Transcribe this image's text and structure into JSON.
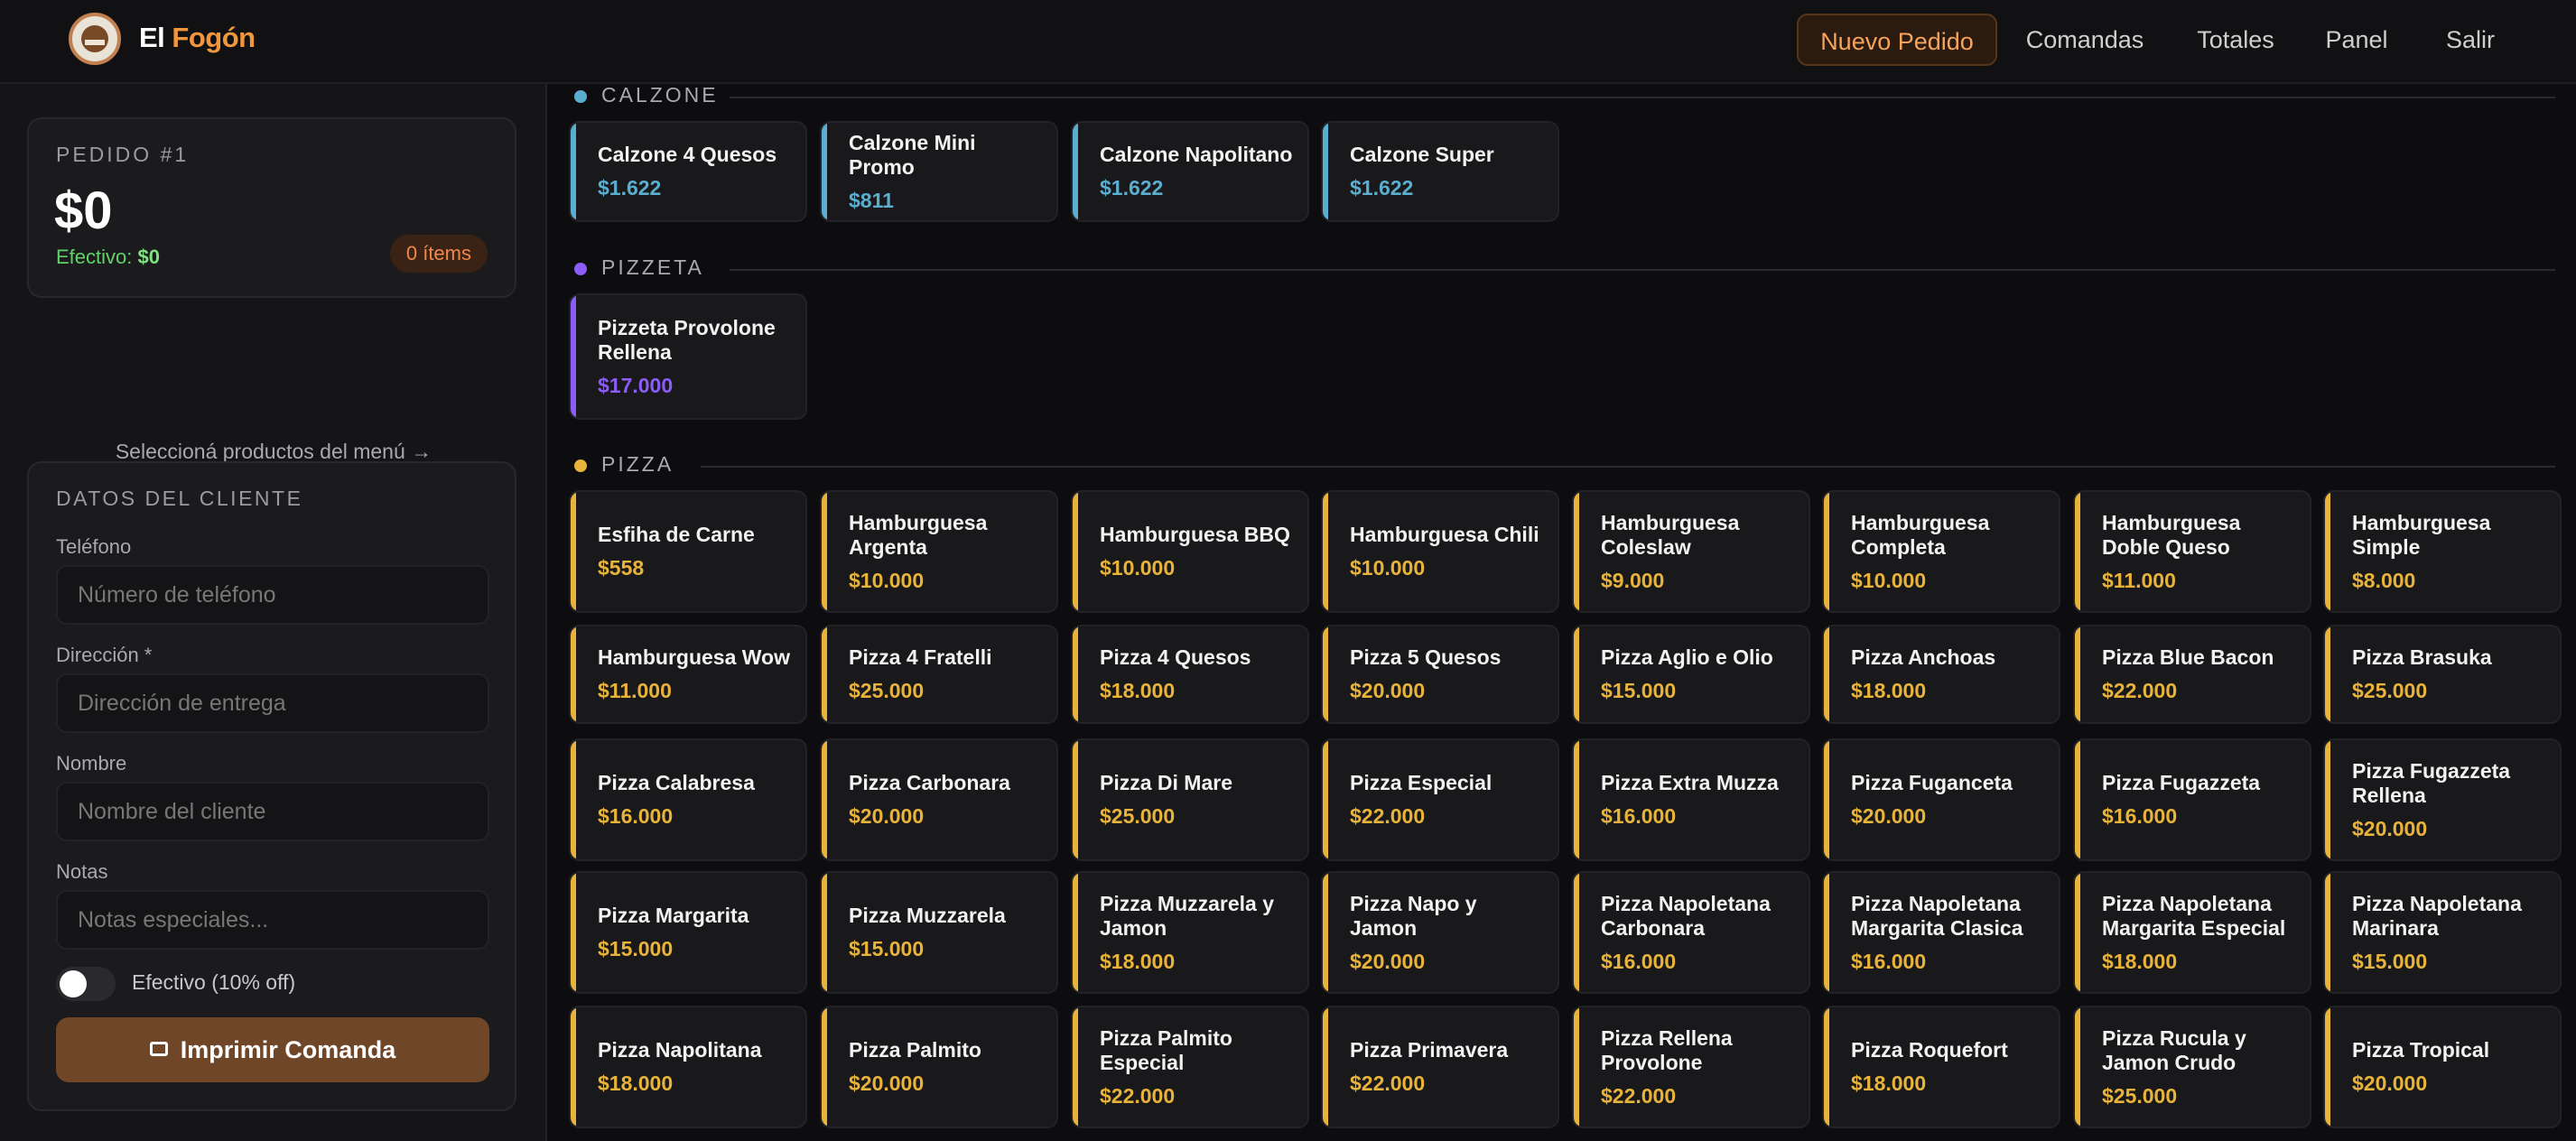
{
  "header": {
    "brand_part1": "El",
    "brand_part2": "Fogón",
    "nav": [
      "Nuevo Pedido",
      "Comandas",
      "Totales",
      "Panel",
      "Salir"
    ]
  },
  "order": {
    "label": "PEDIDO #1",
    "total": "$0",
    "cash_label": "Efectivo:",
    "cash_value": "$0",
    "items_badge": "0 ítems",
    "hint": "Seleccioná productos del menú →"
  },
  "customer": {
    "title": "DATOS DEL CLIENTE",
    "phone_label": "Teléfono",
    "phone_placeholder": "Número de teléfono",
    "address_label": "Dirección *",
    "address_placeholder": "Dirección de entrega",
    "name_label": "Nombre",
    "name_placeholder": "Nombre del cliente",
    "notes_label": "Notas",
    "notes_placeholder": "Notas especiales...",
    "cash_toggle_label": "Efectivo (10% off)",
    "print_button": "Imprimir Comanda"
  },
  "colors": {
    "accent": "#f0963c",
    "calzone": "#5aaed0",
    "pizzeta": "#8b5cf6",
    "pizza": "#e8b33a"
  },
  "sections": [
    {
      "title": "CALZONE",
      "color": "#5aaed0",
      "products": [
        {
          "name": "Calzone 4 Quesos",
          "price": "$1.622"
        },
        {
          "name": "Calzone Mini Promo",
          "price": "$811"
        },
        {
          "name": "Calzone Napolitano",
          "price": "$1.622"
        },
        {
          "name": "Calzone Super",
          "price": "$1.622"
        }
      ]
    },
    {
      "title": "PIZZETA",
      "color": "#8b5cf6",
      "products": [
        {
          "name": "Pizzeta Provolone Rellena",
          "price": "$17.000"
        }
      ]
    },
    {
      "title": "PIZZA",
      "color": "#e8b33a",
      "products": [
        {
          "name": "Esfiha de Carne",
          "price": "$558"
        },
        {
          "name": "Hamburguesa Argenta",
          "price": "$10.000"
        },
        {
          "name": "Hamburguesa BBQ",
          "price": "$10.000"
        },
        {
          "name": "Hamburguesa Chili",
          "price": "$10.000"
        },
        {
          "name": "Hamburguesa Coleslaw",
          "price": "$9.000"
        },
        {
          "name": "Hamburguesa Completa",
          "price": "$10.000"
        },
        {
          "name": "Hamburguesa Doble Queso",
          "price": "$11.000"
        },
        {
          "name": "Hamburguesa Simple",
          "price": "$8.000"
        },
        {
          "name": "Hamburguesa Wow",
          "price": "$11.000"
        },
        {
          "name": "Pizza 4 Fratelli",
          "price": "$25.000"
        },
        {
          "name": "Pizza 4 Quesos",
          "price": "$18.000"
        },
        {
          "name": "Pizza 5 Quesos",
          "price": "$20.000"
        },
        {
          "name": "Pizza Aglio e Olio",
          "price": "$15.000"
        },
        {
          "name": "Pizza Anchoas",
          "price": "$18.000"
        },
        {
          "name": "Pizza Blue Bacon",
          "price": "$22.000"
        },
        {
          "name": "Pizza Brasuka",
          "price": "$25.000"
        },
        {
          "name": "Pizza Calabresa",
          "price": "$16.000"
        },
        {
          "name": "Pizza Carbonara",
          "price": "$20.000"
        },
        {
          "name": "Pizza Di Mare",
          "price": "$25.000"
        },
        {
          "name": "Pizza Especial",
          "price": "$22.000"
        },
        {
          "name": "Pizza Extra Muzza",
          "price": "$16.000"
        },
        {
          "name": "Pizza Fuganceta",
          "price": "$20.000"
        },
        {
          "name": "Pizza Fugazzeta",
          "price": "$16.000"
        },
        {
          "name": "Pizza Fugazzeta Rellena",
          "price": "$20.000"
        },
        {
          "name": "Pizza Margarita",
          "price": "$15.000"
        },
        {
          "name": "Pizza Muzzarela",
          "price": "$15.000"
        },
        {
          "name": "Pizza Muzzarela y Jamon",
          "price": "$18.000"
        },
        {
          "name": "Pizza Napo y Jamon",
          "price": "$20.000"
        },
        {
          "name": "Pizza Napoletana Carbonara",
          "price": "$16.000"
        },
        {
          "name": "Pizza Napoletana Margarita Clasica",
          "price": "$16.000"
        },
        {
          "name": "Pizza Napoletana Margarita Especial",
          "price": "$18.000"
        },
        {
          "name": "Pizza Napoletana Marinara",
          "price": "$15.000"
        },
        {
          "name": "Pizza Napolitana",
          "price": "$18.000"
        },
        {
          "name": "Pizza Palmito",
          "price": "$20.000"
        },
        {
          "name": "Pizza Palmito Especial",
          "price": "$22.000"
        },
        {
          "name": "Pizza Primavera",
          "price": "$22.000"
        },
        {
          "name": "Pizza Rellena Provolone",
          "price": "$22.000"
        },
        {
          "name": "Pizza Roquefort",
          "price": "$18.000"
        },
        {
          "name": "Pizza Rucula y Jamon Crudo",
          "price": "$25.000"
        },
        {
          "name": "Pizza Tropical",
          "price": "$20.000"
        }
      ]
    }
  ]
}
